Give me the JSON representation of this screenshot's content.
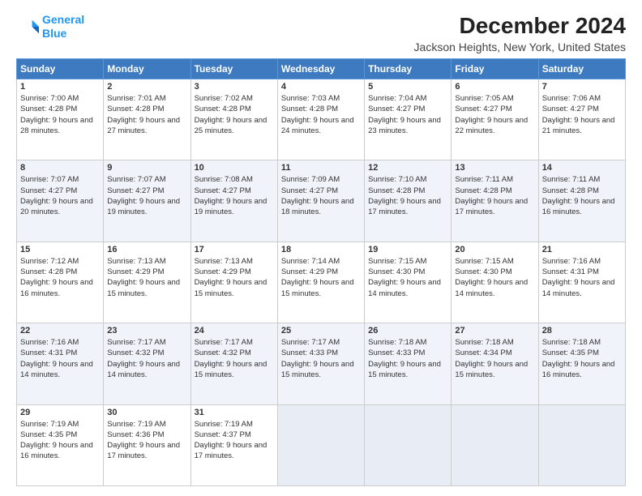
{
  "logo": {
    "line1": "General",
    "line2": "Blue"
  },
  "title": "December 2024",
  "subtitle": "Jackson Heights, New York, United States",
  "headers": [
    "Sunday",
    "Monday",
    "Tuesday",
    "Wednesday",
    "Thursday",
    "Friday",
    "Saturday"
  ],
  "rows": [
    [
      {
        "day": "1",
        "sunrise": "7:00 AM",
        "sunset": "4:28 PM",
        "daylight": "9 hours and 28 minutes."
      },
      {
        "day": "2",
        "sunrise": "7:01 AM",
        "sunset": "4:28 PM",
        "daylight": "9 hours and 27 minutes."
      },
      {
        "day": "3",
        "sunrise": "7:02 AM",
        "sunset": "4:28 PM",
        "daylight": "9 hours and 25 minutes."
      },
      {
        "day": "4",
        "sunrise": "7:03 AM",
        "sunset": "4:28 PM",
        "daylight": "9 hours and 24 minutes."
      },
      {
        "day": "5",
        "sunrise": "7:04 AM",
        "sunset": "4:27 PM",
        "daylight": "9 hours and 23 minutes."
      },
      {
        "day": "6",
        "sunrise": "7:05 AM",
        "sunset": "4:27 PM",
        "daylight": "9 hours and 22 minutes."
      },
      {
        "day": "7",
        "sunrise": "7:06 AM",
        "sunset": "4:27 PM",
        "daylight": "9 hours and 21 minutes."
      }
    ],
    [
      {
        "day": "8",
        "sunrise": "7:07 AM",
        "sunset": "4:27 PM",
        "daylight": "9 hours and 20 minutes."
      },
      {
        "day": "9",
        "sunrise": "7:07 AM",
        "sunset": "4:27 PM",
        "daylight": "9 hours and 19 minutes."
      },
      {
        "day": "10",
        "sunrise": "7:08 AM",
        "sunset": "4:27 PM",
        "daylight": "9 hours and 19 minutes."
      },
      {
        "day": "11",
        "sunrise": "7:09 AM",
        "sunset": "4:27 PM",
        "daylight": "9 hours and 18 minutes."
      },
      {
        "day": "12",
        "sunrise": "7:10 AM",
        "sunset": "4:28 PM",
        "daylight": "9 hours and 17 minutes."
      },
      {
        "day": "13",
        "sunrise": "7:11 AM",
        "sunset": "4:28 PM",
        "daylight": "9 hours and 17 minutes."
      },
      {
        "day": "14",
        "sunrise": "7:11 AM",
        "sunset": "4:28 PM",
        "daylight": "9 hours and 16 minutes."
      }
    ],
    [
      {
        "day": "15",
        "sunrise": "7:12 AM",
        "sunset": "4:28 PM",
        "daylight": "9 hours and 16 minutes."
      },
      {
        "day": "16",
        "sunrise": "7:13 AM",
        "sunset": "4:29 PM",
        "daylight": "9 hours and 15 minutes."
      },
      {
        "day": "17",
        "sunrise": "7:13 AM",
        "sunset": "4:29 PM",
        "daylight": "9 hours and 15 minutes."
      },
      {
        "day": "18",
        "sunrise": "7:14 AM",
        "sunset": "4:29 PM",
        "daylight": "9 hours and 15 minutes."
      },
      {
        "day": "19",
        "sunrise": "7:15 AM",
        "sunset": "4:30 PM",
        "daylight": "9 hours and 14 minutes."
      },
      {
        "day": "20",
        "sunrise": "7:15 AM",
        "sunset": "4:30 PM",
        "daylight": "9 hours and 14 minutes."
      },
      {
        "day": "21",
        "sunrise": "7:16 AM",
        "sunset": "4:31 PM",
        "daylight": "9 hours and 14 minutes."
      }
    ],
    [
      {
        "day": "22",
        "sunrise": "7:16 AM",
        "sunset": "4:31 PM",
        "daylight": "9 hours and 14 minutes."
      },
      {
        "day": "23",
        "sunrise": "7:17 AM",
        "sunset": "4:32 PM",
        "daylight": "9 hours and 14 minutes."
      },
      {
        "day": "24",
        "sunrise": "7:17 AM",
        "sunset": "4:32 PM",
        "daylight": "9 hours and 15 minutes."
      },
      {
        "day": "25",
        "sunrise": "7:17 AM",
        "sunset": "4:33 PM",
        "daylight": "9 hours and 15 minutes."
      },
      {
        "day": "26",
        "sunrise": "7:18 AM",
        "sunset": "4:33 PM",
        "daylight": "9 hours and 15 minutes."
      },
      {
        "day": "27",
        "sunrise": "7:18 AM",
        "sunset": "4:34 PM",
        "daylight": "9 hours and 15 minutes."
      },
      {
        "day": "28",
        "sunrise": "7:18 AM",
        "sunset": "4:35 PM",
        "daylight": "9 hours and 16 minutes."
      }
    ],
    [
      {
        "day": "29",
        "sunrise": "7:19 AM",
        "sunset": "4:35 PM",
        "daylight": "9 hours and 16 minutes."
      },
      {
        "day": "30",
        "sunrise": "7:19 AM",
        "sunset": "4:36 PM",
        "daylight": "9 hours and 17 minutes."
      },
      {
        "day": "31",
        "sunrise": "7:19 AM",
        "sunset": "4:37 PM",
        "daylight": "9 hours and 17 minutes."
      },
      null,
      null,
      null,
      null
    ]
  ]
}
